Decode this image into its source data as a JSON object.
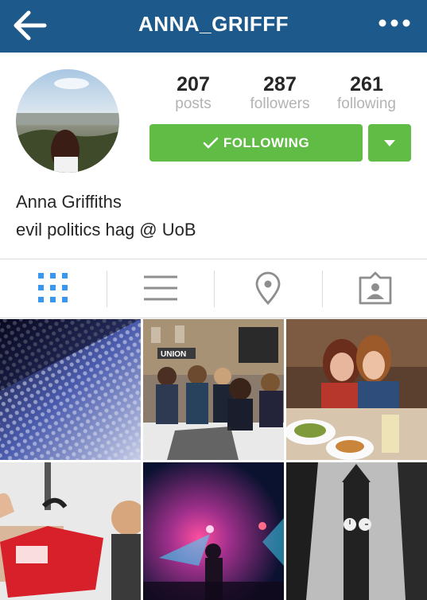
{
  "header": {
    "title": "ANNA_GRIFFF",
    "back_icon": "arrow-left-icon",
    "more_icon": "more-dots-icon",
    "background": "#1d5a8b"
  },
  "profile": {
    "stats": [
      {
        "value": "207",
        "label": "posts"
      },
      {
        "value": "287",
        "label": "followers"
      },
      {
        "value": "261",
        "label": "following"
      }
    ],
    "follow_button": {
      "label": "FOLLOWING",
      "icon": "checkmark-icon",
      "color": "#60bc44"
    },
    "dropdown_icon": "caret-down-icon",
    "name": "Anna Griffiths",
    "bio": "evil politics hag @ UoB"
  },
  "tabs": [
    {
      "name": "grid-view",
      "icon": "grid-icon",
      "active": true
    },
    {
      "name": "list-view",
      "icon": "list-icon",
      "active": false
    },
    {
      "name": "places",
      "icon": "location-pin-icon",
      "active": false
    },
    {
      "name": "tagged",
      "icon": "tagged-person-icon",
      "active": false
    }
  ],
  "accent_color": "#3897f0",
  "photos": [
    {
      "name": "photo-dotted-wall"
    },
    {
      "name": "photo-group-outside-union",
      "text": "UNION"
    },
    {
      "name": "photo-two-girls-dinner"
    },
    {
      "name": "photo-hospital-selfie"
    },
    {
      "name": "photo-concert-lights"
    },
    {
      "name": "photo-clock-tower"
    }
  ]
}
